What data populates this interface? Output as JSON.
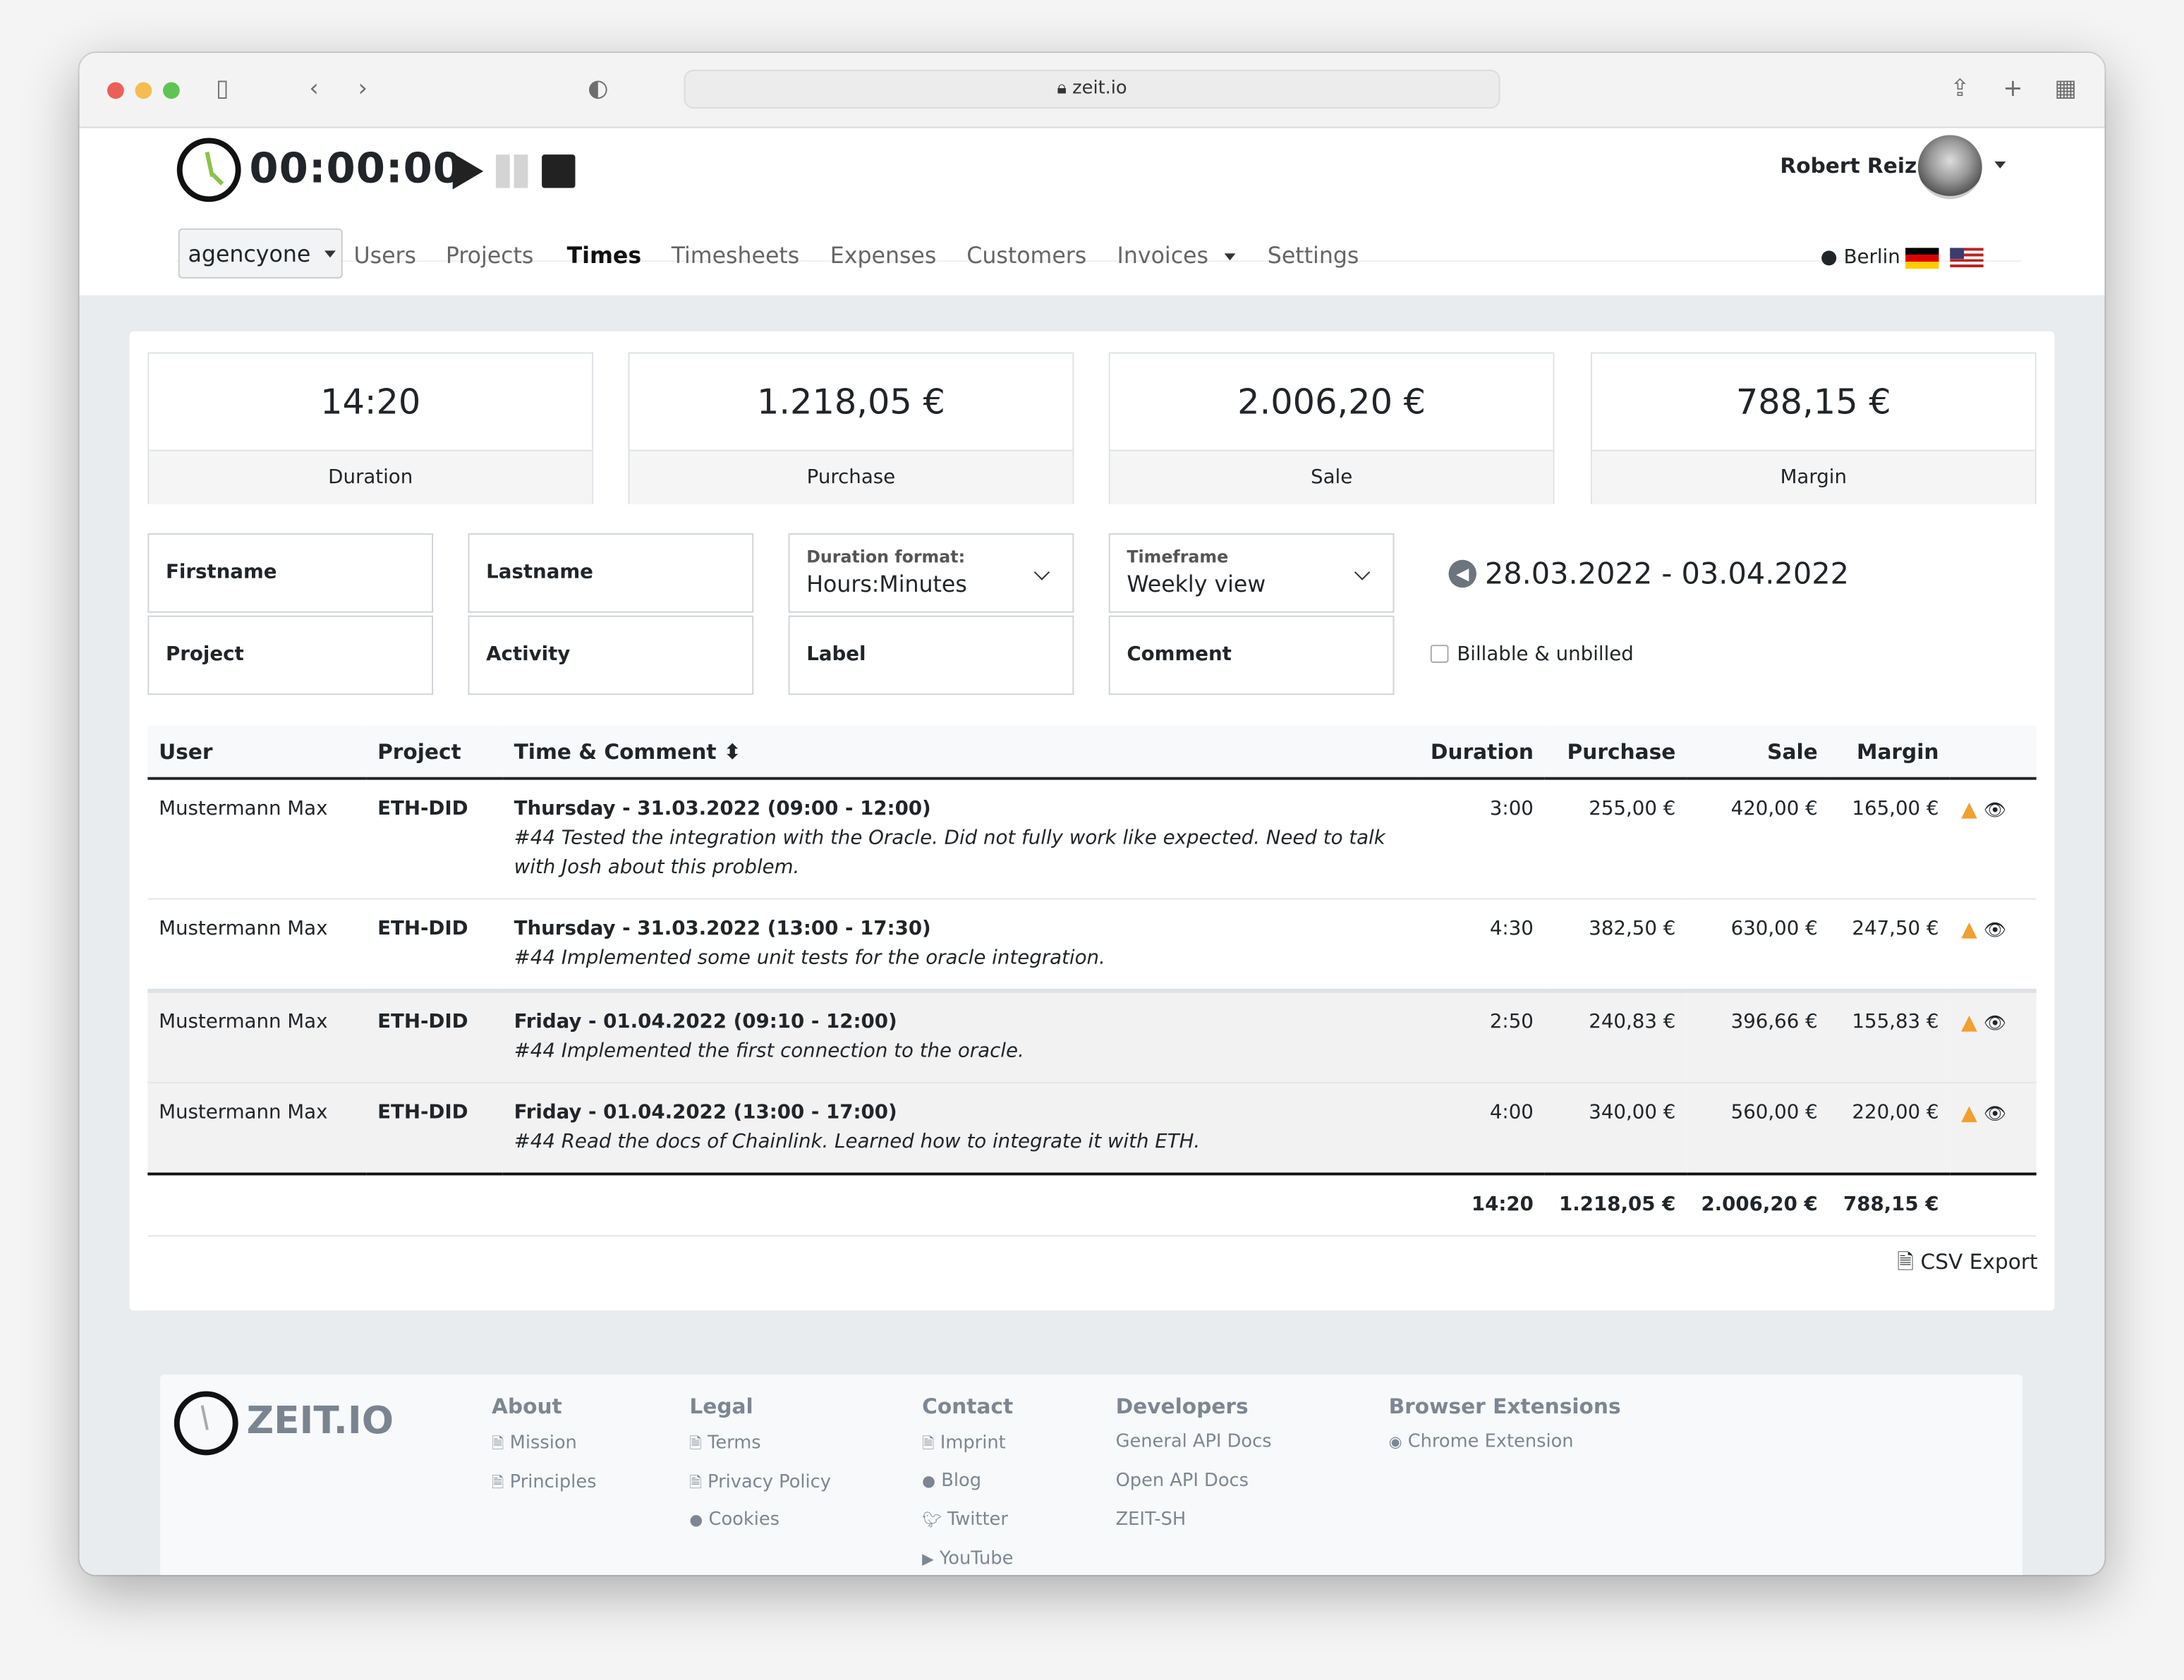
{
  "browser": {
    "url": "zeit.io"
  },
  "timer": {
    "value": "00:00:00"
  },
  "user": {
    "name": "Robert Reiz"
  },
  "nav": {
    "org": "agencyone",
    "items": [
      {
        "label": "Users"
      },
      {
        "label": "Projects"
      },
      {
        "label": "Times",
        "active": true
      },
      {
        "label": "Timesheets"
      },
      {
        "label": "Expenses"
      },
      {
        "label": "Customers"
      },
      {
        "label": "Invoices"
      },
      {
        "label": "Settings"
      }
    ],
    "location": "Berlin"
  },
  "stats": [
    {
      "value": "14:20",
      "label": "Duration"
    },
    {
      "value": "1.218,05 €",
      "label": "Purchase"
    },
    {
      "value": "2.006,20 €",
      "label": "Sale"
    },
    {
      "value": "788,15 €",
      "label": "Margin"
    }
  ],
  "filters": {
    "firstname": "Firstname",
    "lastname": "Lastname",
    "project": "Project",
    "activity": "Activity",
    "label": "Label",
    "comment": "Comment",
    "duration_format": {
      "label": "Duration format:",
      "value": "Hours:Minutes"
    },
    "timeframe": {
      "label": "Timeframe",
      "value": "Weekly view"
    },
    "date_range": "28.03.2022 - 03.04.2022",
    "billable": "Billable & unbilled"
  },
  "table": {
    "headers": {
      "user": "User",
      "project": "Project",
      "time": "Time & Comment",
      "duration": "Duration",
      "purchase": "Purchase",
      "sale": "Sale",
      "margin": "Margin"
    },
    "rows": [
      {
        "user": "Mustermann Max",
        "project": "ETH-DID",
        "time": "Thursday - 31.03.2022 (09:00 - 12:00)",
        "comment": "#44 Tested the integration with the Oracle. Did not fully work like expected. Need to talk with Josh about this problem.",
        "duration": "3:00",
        "purchase": "255,00 €",
        "sale": "420,00 €",
        "margin": "165,00 €"
      },
      {
        "user": "Mustermann Max",
        "project": "ETH-DID",
        "time": "Thursday - 31.03.2022 (13:00 - 17:30)",
        "comment": "#44 Implemented some unit tests for the oracle integration.",
        "duration": "4:30",
        "purchase": "382,50 €",
        "sale": "630,00 €",
        "margin": "247,50 €"
      },
      {
        "user": "Mustermann Max",
        "project": "ETH-DID",
        "time": "Friday - 01.04.2022 (09:10 - 12:00)",
        "comment": "#44 Implemented the first connection to the oracle.",
        "duration": "2:50",
        "purchase": "240,83 €",
        "sale": "396,66 €",
        "margin": "155,83 €"
      },
      {
        "user": "Mustermann Max",
        "project": "ETH-DID",
        "time": "Friday - 01.04.2022 (13:00 - 17:00)",
        "comment": "#44 Read the docs of Chainlink. Learned how to integrate it with ETH.",
        "duration": "4:00",
        "purchase": "340,00 €",
        "sale": "560,00 €",
        "margin": "220,00 €"
      }
    ],
    "totals": {
      "duration": "14:20",
      "purchase": "1.218,05 €",
      "sale": "2.006,20 €",
      "margin": "788,15 €"
    }
  },
  "csv_export": "CSV Export",
  "footer": {
    "brand": "ZEIT.IO",
    "columns": [
      {
        "title": "About",
        "links": [
          "Mission",
          "Principles"
        ]
      },
      {
        "title": "Legal",
        "links": [
          "Terms",
          "Privacy Policy",
          "Cookies"
        ]
      },
      {
        "title": "Contact",
        "links": [
          "Imprint",
          "Blog",
          "Twitter",
          "YouTube"
        ]
      },
      {
        "title": "Developers",
        "links": [
          "General API Docs",
          "Open API Docs",
          "ZEIT-SH"
        ]
      },
      {
        "title": "Browser Extensions",
        "links": [
          "Chrome Extension"
        ]
      }
    ]
  },
  "colors": {
    "warning": "#f0a030",
    "bg": "#e9ecef"
  }
}
